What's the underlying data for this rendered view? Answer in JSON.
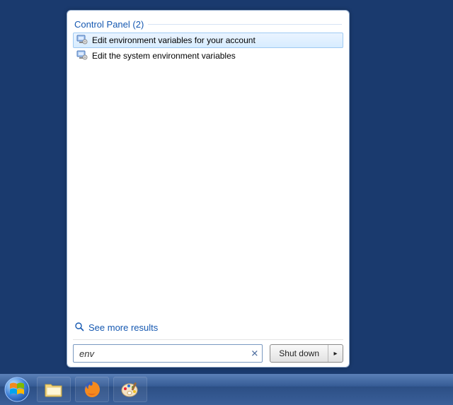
{
  "start_menu": {
    "section": {
      "title": "Control Panel (2)"
    },
    "results": [
      {
        "label": "Edit environment variables for your account",
        "selected": true
      },
      {
        "label": "Edit the system environment variables",
        "selected": false
      }
    ],
    "see_more": "See more results",
    "search_value": "env",
    "shutdown_label": "Shut down"
  },
  "taskbar": {
    "items": [
      "explorer",
      "firefox",
      "paint"
    ]
  }
}
